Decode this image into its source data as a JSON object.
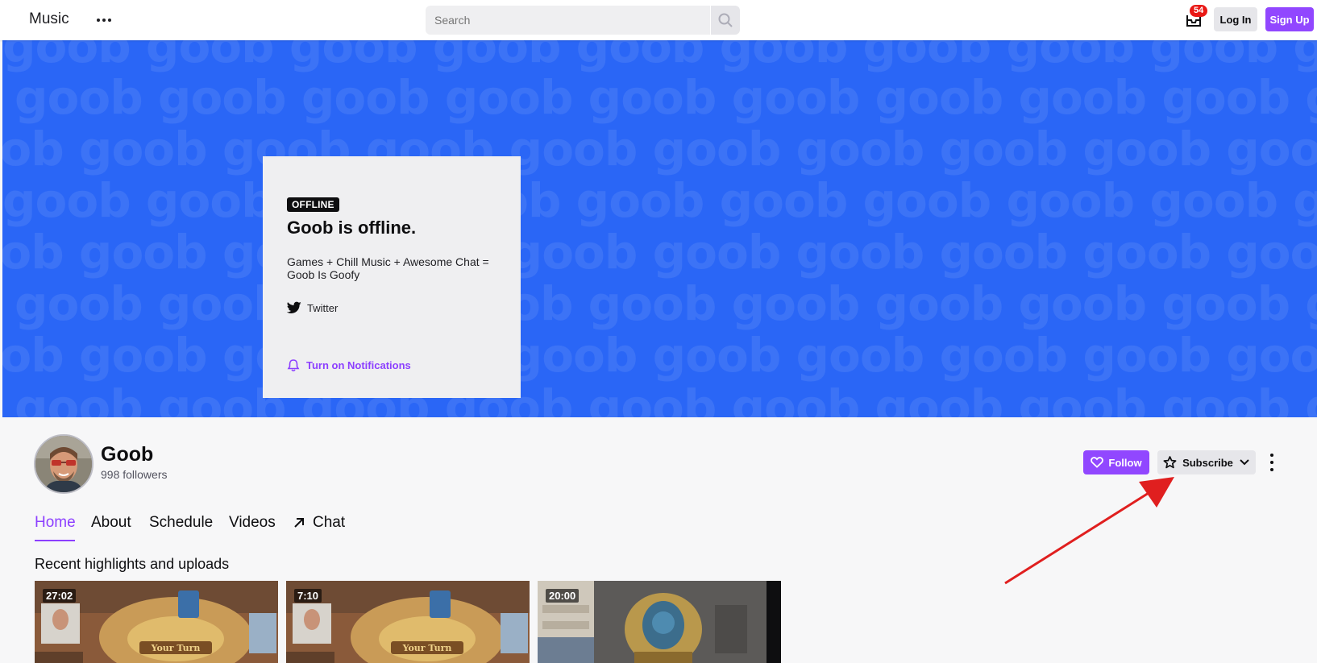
{
  "header": {
    "brand": "Music",
    "search_placeholder": "Search",
    "inbox_count": "54",
    "login_label": "Log In",
    "signup_label": "Sign Up"
  },
  "banner": {
    "pattern_text": "goob",
    "background_color": "#2a66f6",
    "card": {
      "status_tag": "OFFLINE",
      "title": "Goob is offline.",
      "description": "Games + Chill Music + Awesome Chat = Goob Is Goofy",
      "twitter_label": "Twitter",
      "notifications_label": "Turn on Notifications"
    }
  },
  "channel": {
    "name": "Goob",
    "followers": "998 followers",
    "follow_label": "Follow",
    "subscribe_label": "Subscribe"
  },
  "tabs": [
    {
      "label": "Home",
      "active": true
    },
    {
      "label": "About",
      "active": false
    },
    {
      "label": "Schedule",
      "active": false
    },
    {
      "label": "Videos",
      "active": false
    },
    {
      "label": "Chat",
      "active": false,
      "icon": "external-arrow-icon"
    }
  ],
  "highlights": {
    "title": "Recent highlights and uploads",
    "videos": [
      {
        "duration": "27:02"
      },
      {
        "duration": "7:10"
      },
      {
        "duration": "20:00"
      }
    ]
  },
  "colors": {
    "accent": "#9147ff",
    "annotation": "#e01f1f"
  }
}
